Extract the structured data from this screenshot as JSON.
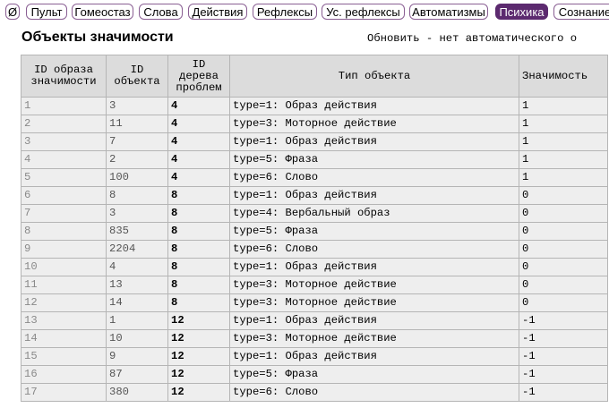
{
  "nav": {
    "items": [
      {
        "label": "Ø"
      },
      {
        "label": "Пульт"
      },
      {
        "label": "Гомеостаз"
      },
      {
        "label": "Слова"
      },
      {
        "label": "Действия"
      },
      {
        "label": "Рефлексы"
      },
      {
        "label": "Ус. рефлексы"
      },
      {
        "label": "Автоматизмы"
      },
      {
        "label": "Психика",
        "active": true
      },
      {
        "label": "Сознание"
      }
    ]
  },
  "page": {
    "title": "Объекты значимости",
    "refresh_text": "Обновить - нет автоматического о"
  },
  "table": {
    "headers": [
      "ID образа значимости",
      "ID объекта",
      "ID дерева проблем",
      "Тип объекта",
      "Значимость"
    ],
    "rows": [
      [
        "1",
        "3",
        "4",
        "type=1: Образ действия",
        "1"
      ],
      [
        "2",
        "11",
        "4",
        "type=3: Моторное действие",
        "1"
      ],
      [
        "3",
        "7",
        "4",
        "type=1: Образ действия",
        "1"
      ],
      [
        "4",
        "2",
        "4",
        "type=5: Фраза",
        "1"
      ],
      [
        "5",
        "100",
        "4",
        "type=6: Слово",
        "1"
      ],
      [
        "6",
        "8",
        "8",
        "type=1: Образ действия",
        "0"
      ],
      [
        "7",
        "3",
        "8",
        "type=4: Вербальный образ",
        "0"
      ],
      [
        "8",
        "835",
        "8",
        "type=5: Фраза",
        "0"
      ],
      [
        "9",
        "2204",
        "8",
        "type=6: Слово",
        "0"
      ],
      [
        "10",
        "4",
        "8",
        "type=1: Образ действия",
        "0"
      ],
      [
        "11",
        "13",
        "8",
        "type=3: Моторное действие",
        "0"
      ],
      [
        "12",
        "14",
        "8",
        "type=3: Моторное действие",
        "0"
      ],
      [
        "13",
        "1",
        "12",
        "type=1: Образ действия",
        "-1"
      ],
      [
        "14",
        "10",
        "12",
        "type=3: Моторное действие",
        "-1"
      ],
      [
        "15",
        "9",
        "12",
        "type=1: Образ действия",
        "-1"
      ],
      [
        "16",
        "87",
        "12",
        "type=5: Фраза",
        "-1"
      ],
      [
        "17",
        "380",
        "12",
        "type=6: Слово",
        "-1"
      ]
    ]
  }
}
